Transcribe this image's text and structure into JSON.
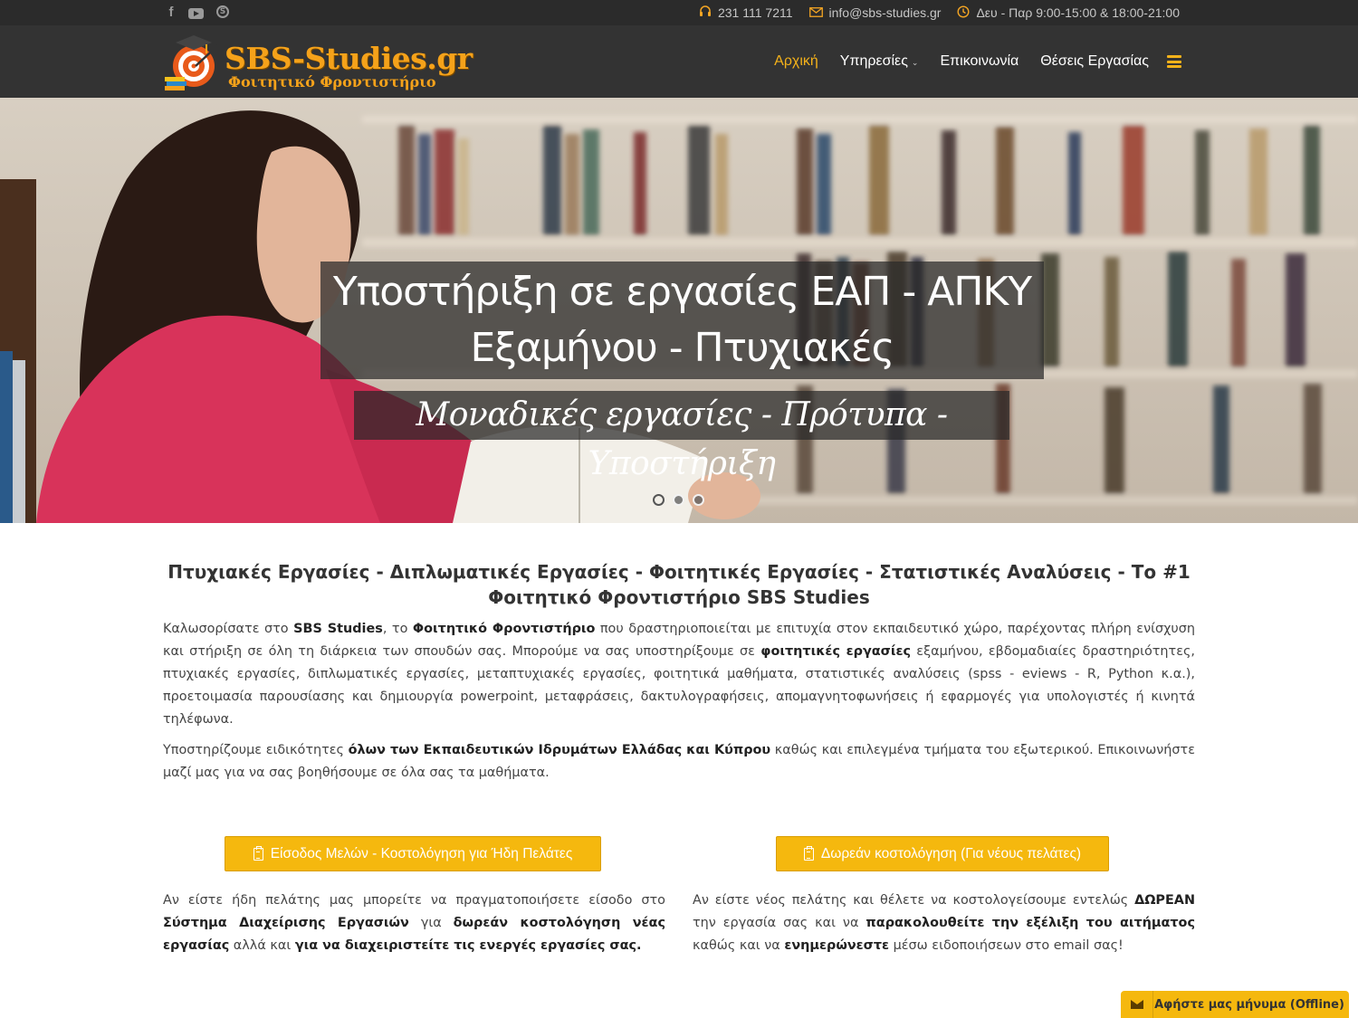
{
  "topbar": {
    "social": [
      "facebook-icon",
      "youtube-icon",
      "skype-icon"
    ],
    "phone": "231 111 7211",
    "email": "info@sbs-studies.gr",
    "hours": "Δευ - Παρ 9:00-15:00 & 18:00-21:00"
  },
  "header": {
    "logo_title": "SBS-Studies.gr",
    "logo_subtitle": "Φοιτητικό Φροντιστήριο",
    "nav": {
      "home": "Αρχική",
      "services": "Υπηρεσίες",
      "contact": "Επικοινωνία",
      "jobs": "Θέσεις Εργασίας"
    }
  },
  "hero": {
    "title_line1": "Υποστήριξη σε εργασίες ΕΑΠ - ΑΠΚΥ",
    "title_line2": "Εξαμήνου - Πτυχιακές",
    "subtitle": "Μοναδικές εργασίες - Πρότυπα - Υποστήριξη",
    "slides": 3,
    "active_slide": 1
  },
  "main": {
    "heading": "Πτυχιακές Εργασίες - Διπλωματικές Εργασίες - Φοιτητικές Εργασίες - Στατιστικές Αναλύσεις - Το #1 Φοιτητικό Φροντιστήριο SBS Studies",
    "p1": {
      "t1": "Καλωσορίσατε στο ",
      "b1": "SBS Studies",
      "t2": ", το ",
      "b2": "Φοιτητικό Φροντιστήριο",
      "t3": " που δραστηριοποιείται με επιτυχία στον εκπαιδευτικό χώρο, παρέχοντας πλήρη ενίσχυση και στήριξη σε όλη τη διάρκεια των σπουδών σας. Μπορούμε να σας υποστηρίξουμε σε ",
      "b3": "φοιτητικές εργασίες",
      "t4": " εξαμήνου, εβδομαδιαίες δραστηριότητες, πτυχιακές εργασίες, διπλωματικές εργασίες, μεταπτυχιακές εργασίες, φοιτητικά μαθήματα, στατιστικές αναλύσεις (spss - eviews - R, Python κ.α.), προετοιμασία παρουσίασης και δημιουργία powerpoint, μεταφράσεις, δακτυλογραφήσεις, απομαγνητοφωνήσεις ή εφαρμογές για υπολογιστές ή κινητά τηλέφωνα."
    },
    "p2": {
      "t1": "Υποστηρίζουμε ειδικότητες ",
      "b1": "όλων των Εκπαιδευτικών Ιδρυμάτων Ελλάδας και Κύπρου",
      "t2": " καθώς και επιλεγμένα τμήματα του εξωτερικού. Επικοινωνήστε μαζί μας για να σας βοηθήσουμε σε όλα σας τα μαθήματα."
    },
    "btn_members": "Είσοδος Μελών - Κοστολόγηση για Ήδη Πελάτες",
    "btn_free": "Δωρεάν κοστολόγηση (Για νέους πελάτες)",
    "left": {
      "t1": "Αν είστε ήδη πελάτης μας μπορείτε να πραγματοποιήσετε είσοδο στο ",
      "b1": "Σύστημα Διαχείρισης Εργασιών",
      "t2": " για ",
      "b2": "δωρεάν κοστολόγηση νέας εργασίας",
      "t3": " αλλά και ",
      "b3": "για να διαχειριστείτε τις ενεργές εργασίες σας."
    },
    "right": {
      "t1": "Αν είστε νέος πελάτης και θέλετε να κοστολογείσουμε εντελώς ",
      "b1": "ΔΩΡΕΑΝ",
      "t2": " την εργασία σας και να ",
      "b2": "παρακολουθείτε την εξέλιξη του αιτήματος",
      "t3": " καθώς και να ",
      "b3": "ενημερώνεστε",
      "t4": " μέσω ειδοποιήσεων στο email σας!"
    }
  },
  "chat": {
    "label": "Αφήστε μας μήνυμα (Offline)",
    "icon": "envelope-icon"
  },
  "colors": {
    "accent": "#f5b80e",
    "header_bg": "#333333",
    "topbar_bg": "#2b2b2b"
  }
}
